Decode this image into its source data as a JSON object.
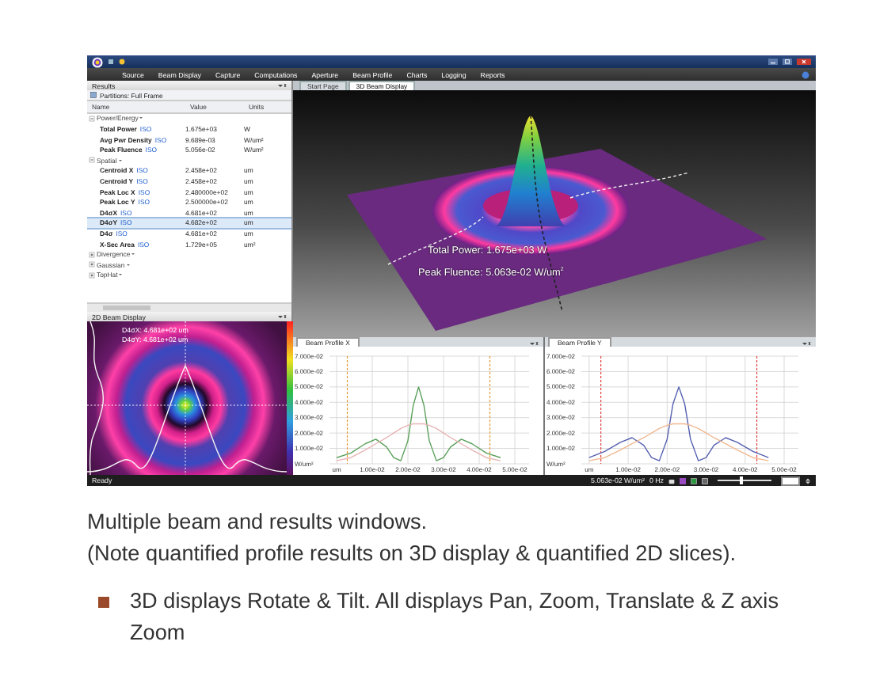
{
  "window": {
    "menu": [
      "Source",
      "Beam Display",
      "Capture",
      "Computations",
      "Aperture",
      "Beam Profile",
      "Charts",
      "Logging",
      "Reports"
    ],
    "panel_title": "Results",
    "tabs": [
      {
        "label": "Start Page",
        "selected": false
      },
      {
        "label": "3D Beam Display",
        "selected": true
      }
    ]
  },
  "results": {
    "partitions": "Partitions: Full Frame",
    "columns": [
      "Name",
      "Value",
      "Units"
    ],
    "groups": [
      {
        "name": "Power/Energy",
        "expanded": true,
        "rows": [
          {
            "name": "Total Power",
            "badge": "ISO",
            "value": "1.675e+03",
            "units": "W",
            "selected": false
          },
          {
            "name": "Avg Pwr Density",
            "badge": "ISO",
            "value": "9.689e-03",
            "units": "W/um²",
            "selected": false
          },
          {
            "name": "Peak Fluence",
            "badge": "ISO",
            "value": "5.056e-02",
            "units": "W/um²",
            "selected": false
          }
        ]
      },
      {
        "name": "Spatial",
        "expanded": true,
        "rows": [
          {
            "name": "Centroid X",
            "badge": "ISO",
            "value": "2.458e+02",
            "units": "um",
            "selected": false
          },
          {
            "name": "Centroid Y",
            "badge": "ISO",
            "value": "2.458e+02",
            "units": "um",
            "selected": false
          },
          {
            "name": "Peak Loc X",
            "badge": "ISO",
            "value": "2.480000e+02",
            "units": "um",
            "selected": false
          },
          {
            "name": "Peak Loc Y",
            "badge": "ISO",
            "value": "2.500000e+02",
            "units": "um",
            "selected": false
          },
          {
            "name": "D4σX",
            "badge": "ISO",
            "value": "4.681e+02",
            "units": "um",
            "selected": false
          },
          {
            "name": "D4σY",
            "badge": "ISO",
            "value": "4.682e+02",
            "units": "um",
            "selected": true
          },
          {
            "name": "D4σ",
            "badge": "ISO",
            "value": "4.681e+02",
            "units": "um",
            "selected": false
          },
          {
            "name": "X-Sec Area",
            "badge": "ISO",
            "value": "1.729e+05",
            "units": "um²",
            "selected": false
          }
        ]
      },
      {
        "name": "Divergence",
        "expanded": false
      },
      {
        "name": "Gaussian",
        "expanded": false
      },
      {
        "name": "TopHat",
        "expanded": false
      }
    ]
  },
  "beam_3d": {
    "overlay": [
      "Total Power: 1.675e+03 W",
      "Peak Fluence: 5.063e-02 W/um$^{2}$"
    ]
  },
  "beam_2d": {
    "title": "2D Beam Display",
    "readouts": [
      "D4σX: 4.681e+02 um",
      "D4σY: 4.681e+02 um"
    ]
  },
  "profiles": [
    {
      "title": "Beam Profile X",
      "chart_data": {
        "type": "line",
        "grid": true,
        "xlim": [
          -0.002,
          0.05
        ],
        "ylim": [
          0,
          0.07
        ],
        "xticks": [
          {
            "value": 0,
            "label": "um"
          },
          {
            "value": 0.01,
            "label": "1.00e-02"
          },
          {
            "value": 0.02,
            "label": "2.00e-02"
          },
          {
            "value": 0.03,
            "label": "3.00e-02"
          },
          {
            "value": 0.04,
            "label": "4.00e-02"
          },
          {
            "value": 0.05,
            "label": "5.00e-02"
          }
        ],
        "yticks": [
          {
            "value": 0,
            "label": "W/um²"
          },
          {
            "value": 0.01,
            "label": "1.000e-02"
          },
          {
            "value": 0.02,
            "label": "2.000e-02"
          },
          {
            "value": 0.03,
            "label": "3.000e-02"
          },
          {
            "value": 0.04,
            "label": "4.000e-02"
          },
          {
            "value": 0.05,
            "label": "5.000e-02"
          },
          {
            "value": 0.06,
            "label": "6.000e-02"
          },
          {
            "value": 0.07,
            "label": "7.000e-02"
          }
        ],
        "x": [
          0,
          0.004,
          0.008,
          0.011,
          0.014,
          0.016,
          0.018,
          0.02,
          0.0215,
          0.023,
          0.0245,
          0.026,
          0.028,
          0.03,
          0.032,
          0.035,
          0.038,
          0.042,
          0.046
        ],
        "series": [
          {
            "color": "#5aa05a",
            "values": [
              0.004,
              0.007,
              0.013,
              0.016,
              0.011,
              0.004,
              0.002,
              0.015,
              0.038,
              0.05,
              0.038,
              0.015,
              0.002,
              0.004,
              0.011,
              0.016,
              0.013,
              0.007,
              0.004
            ]
          },
          {
            "color": "#e8b4b4",
            "values": [
              0.002,
              0.004,
              0.009,
              0.013,
              0.017,
              0.02,
              0.023,
              0.025,
              0.026,
              0.026,
              0.026,
              0.025,
              0.023,
              0.02,
              0.017,
              0.013,
              0.009,
              0.004,
              0.002
            ]
          }
        ],
        "ref_lines": [
          {
            "axis": "x",
            "value": 0.003,
            "color": "#e89a30"
          },
          {
            "axis": "x",
            "value": 0.043,
            "color": "#e89a30"
          }
        ]
      }
    },
    {
      "title": "Beam Profile Y",
      "chart_data": {
        "type": "line",
        "grid": true,
        "xlim": [
          -0.002,
          0.05
        ],
        "ylim": [
          0,
          0.07
        ],
        "xticks": [
          {
            "value": 0,
            "label": "um"
          },
          {
            "value": 0.01,
            "label": "1.00e-02"
          },
          {
            "value": 0.02,
            "label": "2.00e-02"
          },
          {
            "value": 0.03,
            "label": "3.00e-02"
          },
          {
            "value": 0.04,
            "label": "4.00e-02"
          },
          {
            "value": 0.05,
            "label": "5.00e-02"
          }
        ],
        "yticks": [
          {
            "value": 0,
            "label": "W/um²"
          },
          {
            "value": 0.01,
            "label": "1.000e-02"
          },
          {
            "value": 0.02,
            "label": "2.000e-02"
          },
          {
            "value": 0.03,
            "label": "3.000e-02"
          },
          {
            "value": 0.04,
            "label": "4.000e-02"
          },
          {
            "value": 0.05,
            "label": "5.000e-02"
          },
          {
            "value": 0.06,
            "label": "6.000e-02"
          },
          {
            "value": 0.07,
            "label": "7.000e-02"
          }
        ],
        "x": [
          0,
          0.004,
          0.008,
          0.011,
          0.014,
          0.016,
          0.018,
          0.02,
          0.0215,
          0.023,
          0.0245,
          0.026,
          0.028,
          0.03,
          0.032,
          0.035,
          0.038,
          0.042,
          0.046
        ],
        "series": [
          {
            "color": "#5560b0",
            "values": [
              0.004,
              0.008,
              0.014,
              0.017,
              0.012,
              0.004,
              0.002,
              0.016,
              0.039,
              0.05,
              0.039,
              0.016,
              0.002,
              0.004,
              0.012,
              0.017,
              0.014,
              0.008,
              0.004
            ]
          },
          {
            "color": "#f0b890",
            "values": [
              0.002,
              0.004,
              0.009,
              0.013,
              0.017,
              0.02,
              0.023,
              0.025,
              0.026,
              0.026,
              0.026,
              0.025,
              0.023,
              0.02,
              0.017,
              0.013,
              0.009,
              0.004,
              0.002
            ]
          }
        ],
        "ref_lines": [
          {
            "axis": "x",
            "value": 0.003,
            "color": "#e04040"
          },
          {
            "axis": "x",
            "value": 0.043,
            "color": "#e04040"
          }
        ]
      }
    }
  ],
  "status_bar": {
    "text": "Ready",
    "reading": "5.063e-02 W/um²",
    "rate": "0 Hz",
    "zoom_slider": {
      "level": 0.45
    }
  },
  "caption": {
    "lines": [
      "Multiple beam and results windows.",
      "(Note quantified profile results on 3D display & quantified 2D slices)."
    ],
    "bullets": [
      "3D displays Rotate & Tilt. All displays Pan, Zoom, Translate & Z axis Zoom"
    ]
  }
}
